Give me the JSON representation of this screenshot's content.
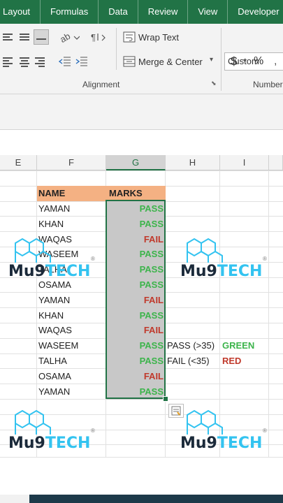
{
  "tabs": [
    "Layout",
    "Formulas",
    "Data",
    "Review",
    "View",
    "Developer"
  ],
  "ribbon": {
    "wrap_text": "Wrap Text",
    "merge_center": "Merge & Center",
    "alignment_group": "Alignment",
    "number_format": "Custom",
    "currency": "$",
    "percent": "%",
    "number_group": "Number"
  },
  "columns": [
    "E",
    "F",
    "G",
    "H",
    "I"
  ],
  "table": {
    "header_name": "NAME",
    "header_marks": "MARKS",
    "rows": [
      {
        "name": "YAMAN",
        "mark": "PASS"
      },
      {
        "name": "KHAN",
        "mark": "PASS"
      },
      {
        "name": "WAQAS",
        "mark": "FAIL"
      },
      {
        "name": "WASEEM",
        "mark": "PASS"
      },
      {
        "name": "TALHA",
        "mark": "PASS"
      },
      {
        "name": "OSAMA",
        "mark": "PASS"
      },
      {
        "name": "YAMAN",
        "mark": "FAIL"
      },
      {
        "name": "KHAN",
        "mark": "PASS"
      },
      {
        "name": "WAQAS",
        "mark": "FAIL"
      },
      {
        "name": "WASEEM",
        "mark": "PASS"
      },
      {
        "name": "TALHA",
        "mark": "PASS"
      },
      {
        "name": "OSAMA",
        "mark": "FAIL"
      },
      {
        "name": "YAMAN",
        "mark": "PASS"
      }
    ]
  },
  "legend": {
    "pass_rule": "PASS (>35)",
    "pass_color_name": "GREEN",
    "fail_rule": "FAIL (<35)",
    "fail_color_name": "RED"
  },
  "watermark": {
    "mu": "Mu9",
    "tech": "TECH",
    "reg": "®"
  },
  "colors": {
    "excel_green": "#217346",
    "pass": "#3cb44b",
    "fail": "#c0392b",
    "header_fill": "#f4b183",
    "tech_blue": "#33c3f0"
  }
}
